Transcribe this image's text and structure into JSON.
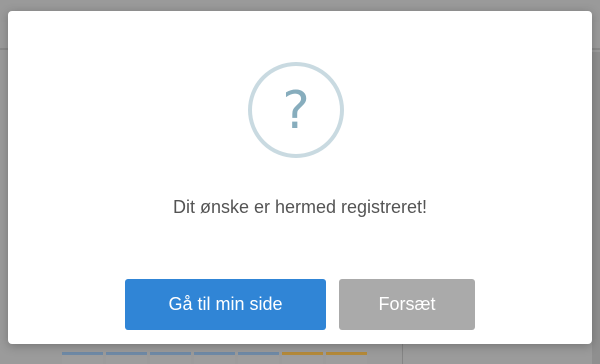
{
  "dialog": {
    "icon": "question-mark-icon",
    "icon_glyph": "?",
    "message": "Dit ønske er hermed registreret!",
    "confirm_label": "Gå til min side",
    "cancel_label": "Forsæt"
  },
  "colors": {
    "confirm_button": "#3085d6",
    "cancel_button": "#aaaaaa",
    "icon_border": "#c9dae1",
    "icon_glyph": "#87adbd",
    "backdrop": "#9b9b9b"
  }
}
